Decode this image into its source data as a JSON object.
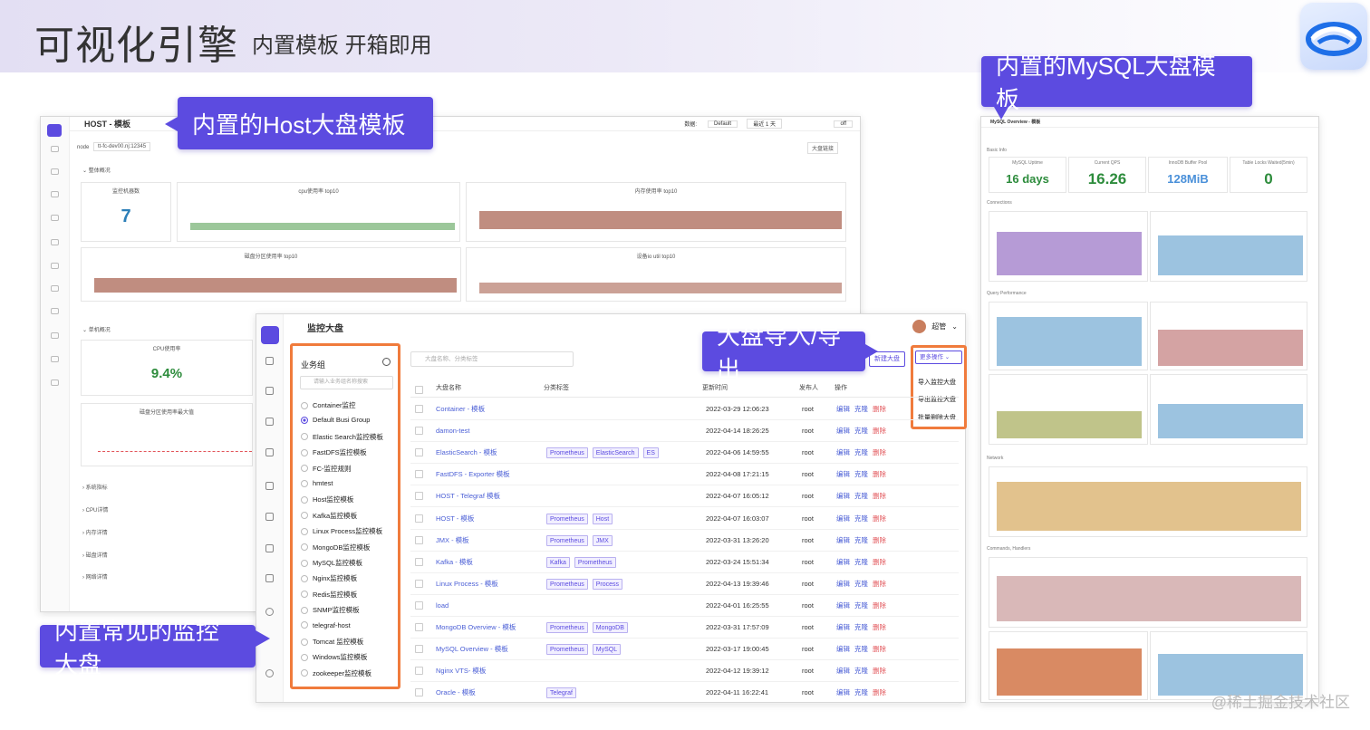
{
  "slide": {
    "title": "可视化引擎",
    "subtitle": "内置模板 开箱即用",
    "watermark": "@稀土掘金技术社区"
  },
  "callouts": {
    "host": "内置的Host大盘模板",
    "mysql": "内置的MySQL大盘模板",
    "common": "内置常见的监控大盘",
    "io": "大盘导入/导出"
  },
  "host": {
    "title": "HOST - 模板",
    "node_label": "node",
    "node_value": "tt-fc-dev00.nj:12345",
    "datasource_label": "数据:",
    "datasource_value": "Default",
    "range_value": "最近 1 天",
    "refresh_value": "off",
    "share_btn": "大盘链接",
    "section_overview": "整体概况",
    "section_single": "单机概况",
    "panels": {
      "count_title": "监控机器数",
      "count_value": "7",
      "cpu_top": "cpu使用率 top10",
      "mem_top": "内存使用率 top10",
      "disk_top": "磁盘分区使用率 top10",
      "io_top": "设备io util top10",
      "cpu_use": "CPU使用率",
      "cpu_value": "9.4%",
      "disk_max": "磁盘分区使用率最大值"
    },
    "collapsed": [
      "系统指标",
      "CPU详情",
      "内存详情",
      "磁盘详情",
      "网络详情"
    ]
  },
  "mysql": {
    "title": "MySQL Overview - 模板",
    "stats": [
      {
        "label": "MySQL Uptime",
        "value": "16 days",
        "color": "#2d8c3c"
      },
      {
        "label": "Current QPS",
        "value": "16.26",
        "color": "#2d8c3c"
      },
      {
        "label": "InnoDB Buffer Pool",
        "value": "128MiB",
        "color": "#4a90d9"
      },
      {
        "label": "Table Locks Waited(5min)",
        "value": "0",
        "color": "#2d8c3c"
      }
    ],
    "sections": [
      "Basic Info",
      "Connections",
      "Query Performance",
      "Network",
      "Commands, Handlers"
    ]
  },
  "board": {
    "title": "监控大盘",
    "user": "超管",
    "groups_title": "业务组",
    "groups_search": "请输入业务组名称搜索",
    "groups": [
      "Container监控",
      "Default Busi Group",
      "Elastic Search监控模板",
      "FastDFS监控模板",
      "FC-监控规则",
      "hmtest",
      "Host监控模板",
      "Kafka监控模板",
      "Linux Process监控模板",
      "MongoDB监控模板",
      "MySQL监控模板",
      "Nginx监控模板",
      "Redis监控模板",
      "SNMP监控模板",
      "telegraf-host",
      "Tomcat 监控模板",
      "Windows监控模板",
      "zookeeper监控模板"
    ],
    "selected_group": 1,
    "search_placeholder": "大盘名称、分类标签",
    "new_btn": "新建大盘",
    "more_btn": "更多操作",
    "more_items": [
      "导入监控大盘",
      "导出监控大盘",
      "批量删除大盘"
    ],
    "columns": {
      "name": "大盘名称",
      "tags": "分类标签",
      "time": "更新时间",
      "owner": "发布人",
      "ops": "操作"
    },
    "op_labels": {
      "edit": "编辑",
      "clone": "克隆",
      "del": "删除"
    },
    "rows": [
      {
        "name": "Container - 模板",
        "tags": [],
        "time": "2022-03-29 12:06:23",
        "owner": "root"
      },
      {
        "name": "damon-test",
        "tags": [],
        "time": "2022-04-14 18:26:25",
        "owner": "root"
      },
      {
        "name": "ElasticSearch - 模板",
        "tags": [
          "Prometheus",
          "ElasticSearch",
          "ES"
        ],
        "time": "2022-04-06 14:59:55",
        "owner": "root"
      },
      {
        "name": "FastDFS - Exporter 模板",
        "tags": [],
        "time": "2022-04-08 17:21:15",
        "owner": "root"
      },
      {
        "name": "HOST - Telegraf 模板",
        "tags": [],
        "time": "2022-04-07 16:05:12",
        "owner": "root"
      },
      {
        "name": "HOST - 模板",
        "tags": [
          "Prometheus",
          "Host"
        ],
        "time": "2022-04-07 16:03:07",
        "owner": "root"
      },
      {
        "name": "JMX - 模板",
        "tags": [
          "Prometheus",
          "JMX"
        ],
        "time": "2022-03-31 13:26:20",
        "owner": "root"
      },
      {
        "name": "Kafka - 模板",
        "tags": [
          "Kafka",
          "Prometheus"
        ],
        "time": "2022-03-24 15:51:34",
        "owner": "root"
      },
      {
        "name": "Linux Process - 模板",
        "tags": [
          "Prometheus",
          "Process"
        ],
        "time": "2022-04-13 19:39:46",
        "owner": "root"
      },
      {
        "name": "load",
        "tags": [],
        "time": "2022-04-01 16:25:55",
        "owner": "root"
      },
      {
        "name": "MongoDB Overview - 模板",
        "tags": [
          "Prometheus",
          "MongoDB"
        ],
        "time": "2022-03-31 17:57:09",
        "owner": "root"
      },
      {
        "name": "MySQL Overview - 模板",
        "tags": [
          "Prometheus",
          "MySQL"
        ],
        "time": "2022-03-17 19:00:45",
        "owner": "root"
      },
      {
        "name": "Nginx VTS- 模板",
        "tags": [],
        "time": "2022-04-12 19:39:12",
        "owner": "root"
      },
      {
        "name": "Oracle - 模板",
        "tags": [
          "Telegraf"
        ],
        "time": "2022-04-11 16:22:41",
        "owner": "root"
      }
    ]
  },
  "colors": {
    "accent": "#5c4be0",
    "highlight": "#f07b3c",
    "delete": "#e2555a"
  }
}
